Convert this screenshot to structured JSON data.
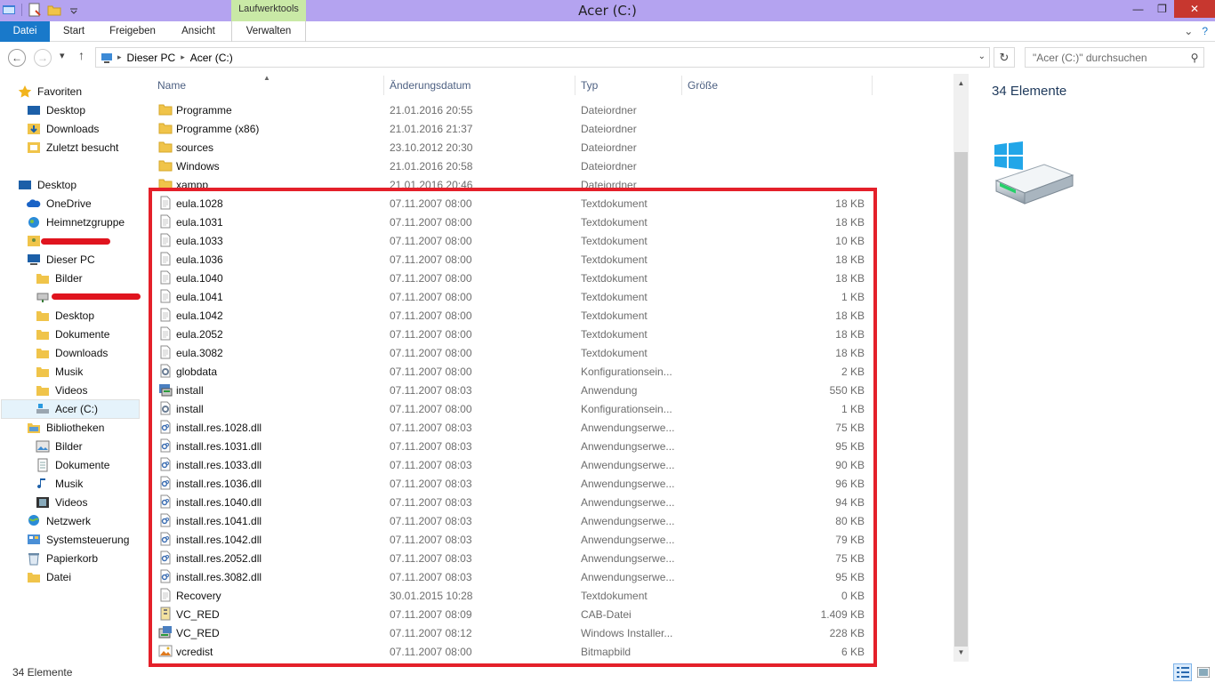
{
  "window": {
    "title": "Acer (C:)",
    "context_tab_header": "Laufwerktools",
    "minimize": "—",
    "maximize": "❐",
    "close": "✕"
  },
  "ribbon": {
    "tabs": [
      "Datei",
      "Start",
      "Freigeben",
      "Ansicht",
      "Verwalten"
    ],
    "collapse_glyph": "⌄",
    "help_glyph": "?"
  },
  "nav": {
    "back_glyph": "←",
    "forward_glyph": "→",
    "recent_glyph": "▾",
    "up_glyph": "↑",
    "breadcrumb": [
      "Dieser PC",
      "Acer (C:)"
    ],
    "crumb_sep": "▸",
    "address_dropdown": "⌄",
    "refresh_glyph": "↻",
    "search_placeholder": "\"Acer (C:)\" durchsuchen",
    "search_glyph": "⚲"
  },
  "navpane": {
    "items": [
      {
        "label": "Favoriten",
        "icon": "star-icon"
      },
      {
        "label": "Desktop",
        "icon": "desktop-icon"
      },
      {
        "label": "Downloads",
        "icon": "downloads-icon"
      },
      {
        "label": "Zuletzt besucht",
        "icon": "recent-icon"
      },
      {
        "label": "Desktop",
        "icon": "desktop-icon"
      },
      {
        "label": "OneDrive",
        "icon": "onedrive-icon"
      },
      {
        "label": "Heimnetzgruppe",
        "icon": "homegroup-icon"
      },
      {
        "label": "",
        "icon": "user-folder-icon"
      },
      {
        "label": "Dieser PC",
        "icon": "pc-icon"
      },
      {
        "label": "Bilder",
        "icon": "folder-icon"
      },
      {
        "label": "",
        "icon": "network-drive-icon"
      },
      {
        "label": "Desktop",
        "icon": "folder-icon"
      },
      {
        "label": "Dokumente",
        "icon": "folder-icon"
      },
      {
        "label": "Downloads",
        "icon": "folder-icon"
      },
      {
        "label": "Musik",
        "icon": "folder-icon"
      },
      {
        "label": "Videos",
        "icon": "folder-icon"
      },
      {
        "label": "Acer (C:)",
        "icon": "drive-icon"
      },
      {
        "label": "Bibliotheken",
        "icon": "libraries-icon"
      },
      {
        "label": "Bilder",
        "icon": "pictures-icon"
      },
      {
        "label": "Dokumente",
        "icon": "documents-icon"
      },
      {
        "label": "Musik",
        "icon": "music-icon"
      },
      {
        "label": "Videos",
        "icon": "videos-icon"
      },
      {
        "label": "Netzwerk",
        "icon": "network-icon"
      },
      {
        "label": "Systemsteuerung",
        "icon": "control-panel-icon"
      },
      {
        "label": "Papierkorb",
        "icon": "recycle-bin-icon"
      },
      {
        "label": "Datei",
        "icon": "folder-icon"
      }
    ]
  },
  "columns": {
    "name": "Name",
    "date": "Änderungsdatum",
    "type": "Typ",
    "size": "Größe",
    "sort_glyph": "▲"
  },
  "files": [
    {
      "name": "Programme",
      "date": "21.01.2016 20:55",
      "type": "Dateiordner",
      "size": "",
      "icon": "folder-icon"
    },
    {
      "name": "Programme (x86)",
      "date": "21.01.2016 21:37",
      "type": "Dateiordner",
      "size": "",
      "icon": "folder-icon"
    },
    {
      "name": "sources",
      "date": "23.10.2012 20:30",
      "type": "Dateiordner",
      "size": "",
      "icon": "folder-icon"
    },
    {
      "name": "Windows",
      "date": "21.01.2016 20:58",
      "type": "Dateiordner",
      "size": "",
      "icon": "folder-icon"
    },
    {
      "name": "xampp",
      "date": "21.01.2016 20:46",
      "type": "Dateiordner",
      "size": "",
      "icon": "folder-icon"
    },
    {
      "name": "eula.1028",
      "date": "07.11.2007 08:00",
      "type": "Textdokument",
      "size": "18 KB",
      "icon": "text-file-icon"
    },
    {
      "name": "eula.1031",
      "date": "07.11.2007 08:00",
      "type": "Textdokument",
      "size": "18 KB",
      "icon": "text-file-icon"
    },
    {
      "name": "eula.1033",
      "date": "07.11.2007 08:00",
      "type": "Textdokument",
      "size": "10 KB",
      "icon": "text-file-icon"
    },
    {
      "name": "eula.1036",
      "date": "07.11.2007 08:00",
      "type": "Textdokument",
      "size": "18 KB",
      "icon": "text-file-icon"
    },
    {
      "name": "eula.1040",
      "date": "07.11.2007 08:00",
      "type": "Textdokument",
      "size": "18 KB",
      "icon": "text-file-icon"
    },
    {
      "name": "eula.1041",
      "date": "07.11.2007 08:00",
      "type": "Textdokument",
      "size": "1 KB",
      "icon": "text-file-icon"
    },
    {
      "name": "eula.1042",
      "date": "07.11.2007 08:00",
      "type": "Textdokument",
      "size": "18 KB",
      "icon": "text-file-icon"
    },
    {
      "name": "eula.2052",
      "date": "07.11.2007 08:00",
      "type": "Textdokument",
      "size": "18 KB",
      "icon": "text-file-icon"
    },
    {
      "name": "eula.3082",
      "date": "07.11.2007 08:00",
      "type": "Textdokument",
      "size": "18 KB",
      "icon": "text-file-icon"
    },
    {
      "name": "globdata",
      "date": "07.11.2007 08:00",
      "type": "Konfigurationsein...",
      "size": "2 KB",
      "icon": "config-file-icon"
    },
    {
      "name": "install",
      "date": "07.11.2007 08:03",
      "type": "Anwendung",
      "size": "550 KB",
      "icon": "installer-app-icon"
    },
    {
      "name": "install",
      "date": "07.11.2007 08:00",
      "type": "Konfigurationsein...",
      "size": "1 KB",
      "icon": "config-file-icon"
    },
    {
      "name": "install.res.1028.dll",
      "date": "07.11.2007 08:03",
      "type": "Anwendungserwe...",
      "size": "75 KB",
      "icon": "dll-file-icon"
    },
    {
      "name": "install.res.1031.dll",
      "date": "07.11.2007 08:03",
      "type": "Anwendungserwe...",
      "size": "95 KB",
      "icon": "dll-file-icon"
    },
    {
      "name": "install.res.1033.dll",
      "date": "07.11.2007 08:03",
      "type": "Anwendungserwe...",
      "size": "90 KB",
      "icon": "dll-file-icon"
    },
    {
      "name": "install.res.1036.dll",
      "date": "07.11.2007 08:03",
      "type": "Anwendungserwe...",
      "size": "96 KB",
      "icon": "dll-file-icon"
    },
    {
      "name": "install.res.1040.dll",
      "date": "07.11.2007 08:03",
      "type": "Anwendungserwe...",
      "size": "94 KB",
      "icon": "dll-file-icon"
    },
    {
      "name": "install.res.1041.dll",
      "date": "07.11.2007 08:03",
      "type": "Anwendungserwe...",
      "size": "80 KB",
      "icon": "dll-file-icon"
    },
    {
      "name": "install.res.1042.dll",
      "date": "07.11.2007 08:03",
      "type": "Anwendungserwe...",
      "size": "79 KB",
      "icon": "dll-file-icon"
    },
    {
      "name": "install.res.2052.dll",
      "date": "07.11.2007 08:03",
      "type": "Anwendungserwe...",
      "size": "75 KB",
      "icon": "dll-file-icon"
    },
    {
      "name": "install.res.3082.dll",
      "date": "07.11.2007 08:03",
      "type": "Anwendungserwe...",
      "size": "95 KB",
      "icon": "dll-file-icon"
    },
    {
      "name": "Recovery",
      "date": "30.01.2015 10:28",
      "type": "Textdokument",
      "size": "0 KB",
      "icon": "text-file-icon"
    },
    {
      "name": "VC_RED",
      "date": "07.11.2007 08:09",
      "type": "CAB-Datei",
      "size": "1.409 KB",
      "icon": "cab-file-icon"
    },
    {
      "name": "VC_RED",
      "date": "07.11.2007 08:12",
      "type": "Windows Installer...",
      "size": "228 KB",
      "icon": "msi-file-icon"
    },
    {
      "name": "vcredist",
      "date": "07.11.2007 08:00",
      "type": "Bitmapbild",
      "size": "6 KB",
      "icon": "bitmap-file-icon"
    }
  ],
  "scrollbar": {
    "up_glyph": "▲",
    "down_glyph": "▼"
  },
  "details": {
    "count": "34 Elemente",
    "icon": "windows-drive-icon"
  },
  "status": {
    "count": "34 Elemente"
  },
  "colors": {
    "accent": "#1979ca",
    "titlebar": "#b4a3f0",
    "context_tab": "#c9e9a6",
    "highlight": "#e4202a"
  }
}
